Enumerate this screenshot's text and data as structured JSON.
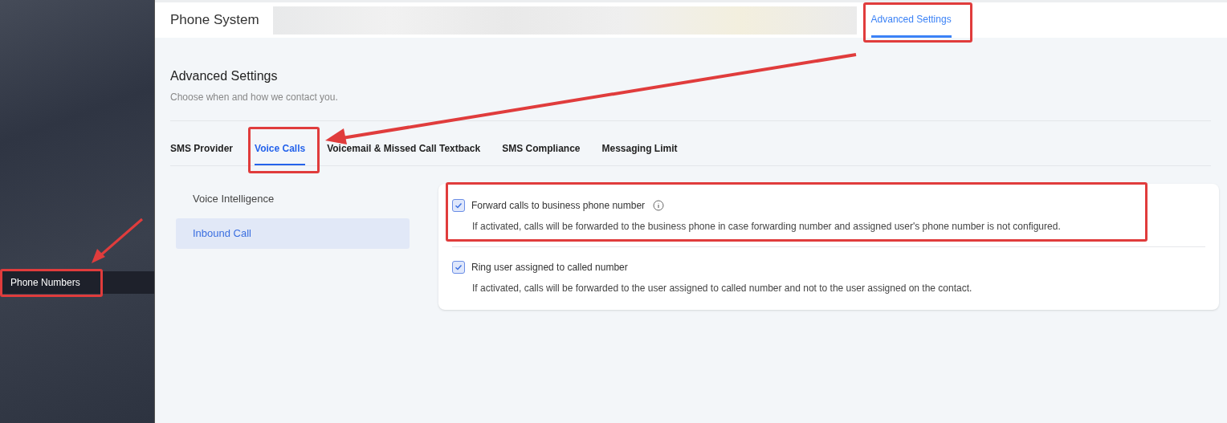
{
  "sidebar": {
    "items": [
      {
        "label": "Phone Numbers",
        "selected": true
      }
    ]
  },
  "header": {
    "title": "Phone System",
    "tabs": [
      {
        "label": "Advanced Settings",
        "selected": true
      }
    ]
  },
  "section": {
    "title": "Advanced Settings",
    "subtitle": "Choose when and how we contact you."
  },
  "tabs": [
    {
      "label": "SMS Provider",
      "selected": false
    },
    {
      "label": "Voice Calls",
      "selected": true
    },
    {
      "label": "Voicemail & Missed Call Textback",
      "selected": false
    },
    {
      "label": "SMS Compliance",
      "selected": false
    },
    {
      "label": "Messaging Limit",
      "selected": false
    }
  ],
  "side_menu": [
    {
      "label": "Voice Intelligence",
      "selected": false
    },
    {
      "label": "Inbound Call",
      "selected": true
    }
  ],
  "settings": [
    {
      "label": "Forward calls to business phone number",
      "info": true,
      "checked": true,
      "description": "If activated, calls will be forwarded to the business phone in case forwarding number and assigned user's phone number is not configured."
    },
    {
      "label": "Ring user assigned to called number",
      "info": false,
      "checked": true,
      "description": "If activated, calls will be forwarded to the user assigned to called number and not to the user assigned on the contact."
    }
  ]
}
